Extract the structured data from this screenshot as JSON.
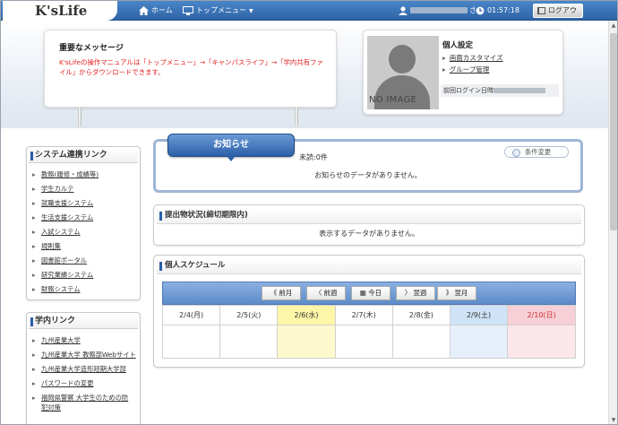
{
  "app": {
    "logo": "K'sLife"
  },
  "topnav": {
    "home": "ホーム",
    "top_menu": "トップメニュー",
    "user_suffix": "さん",
    "clock": "01:57:18",
    "logout": "ログアウト"
  },
  "message": {
    "title": "重要なメッセージ",
    "body": "K'sLifeの操作マニュアルは「トップメニュー」→「キャンパスライフ」→「学内共有ファイル」からダウンロードできます。"
  },
  "profile": {
    "no_image": "NO IMAGE",
    "title": "個人設定",
    "links": [
      "画面カスタマイズ",
      "グループ管理"
    ],
    "last_login_label": "前回ログイン日時"
  },
  "sidebar": {
    "system_links": {
      "title": "システム連携リンク",
      "items": [
        "教務(履修・成績等)",
        "学生カルテ",
        "就職支援システム",
        "生活支援システム",
        "入試システム",
        "規則集",
        "図書館ポータル",
        "研究業績システム",
        "財務システム"
      ]
    },
    "campus_links": {
      "title": "学内リンク",
      "items": [
        "九州産業大学",
        "九州産業大学 教務部Webサイト",
        "九州産業大学造形短期大学部",
        "パスワードの変更",
        "福岡県警察 大学生のための防犯対策"
      ]
    }
  },
  "notice": {
    "tab": "お知らせ",
    "unread": "未読:0件",
    "filter": "条件変更",
    "empty": "お知らせのデータがありません。"
  },
  "submissions": {
    "title": "提出物状況(締切期限内)",
    "empty": "表示するデータがありません。"
  },
  "schedule": {
    "title": "個人スケジュール",
    "buttons": {
      "prev_month": "前月",
      "prev_week": "前週",
      "today": "今日",
      "next_week": "翌週",
      "next_month": "翌月"
    },
    "days": [
      "2/4(月)",
      "2/5(火)",
      "2/6(水)",
      "2/7(木)",
      "2/8(金)",
      "2/9(土)",
      "2/10(日)"
    ],
    "day_colors": {
      "today_bg": "#fdf5a8",
      "today_cell": "#fdf9cc",
      "sat_bg": "#cfe3f7",
      "sat_cell": "#e6f0fb",
      "sun_bg": "#f7cfd6",
      "sun_cell": "#fbe6ea"
    }
  },
  "colors": {
    "accent": "#2e64a6",
    "alert": "#e41e1e"
  }
}
